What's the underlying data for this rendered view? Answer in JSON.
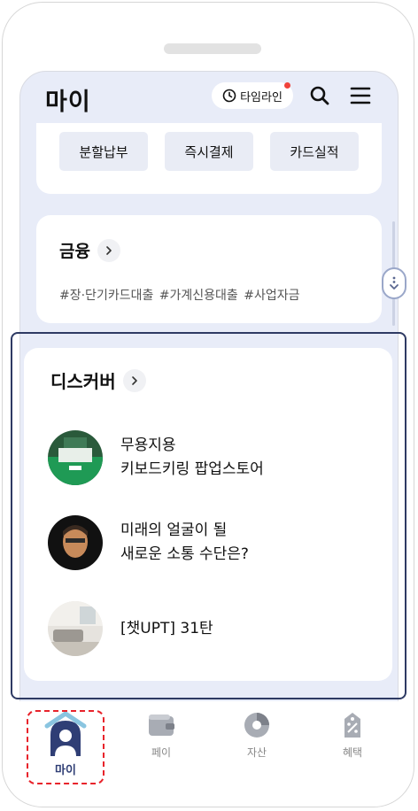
{
  "header": {
    "title": "마이",
    "timeline_label": "타임라인"
  },
  "payment_chips": [
    "분할납부",
    "즉시결제",
    "카드실적"
  ],
  "finance": {
    "title": "금융",
    "tags": "#장·단기카드대출  #가계신용대출  #사업자금"
  },
  "discover": {
    "title": "디스커버",
    "items": [
      {
        "line1": "무용지용",
        "line2": "키보드키링 팝업스토어"
      },
      {
        "line1": "미래의 얼굴이 될",
        "line2": "새로운 소통 수단은?"
      },
      {
        "line1": "[챗UPT] 31탄",
        "line2": ""
      }
    ]
  },
  "nav": {
    "my": "마이",
    "pay": "페이",
    "assets": "자산",
    "benefits": "혜택"
  },
  "colors": {
    "accent": "#2f3e75",
    "highlight_border": "#2e3a63",
    "active_marker": "#e8232b",
    "background": "#e8ecf8"
  }
}
